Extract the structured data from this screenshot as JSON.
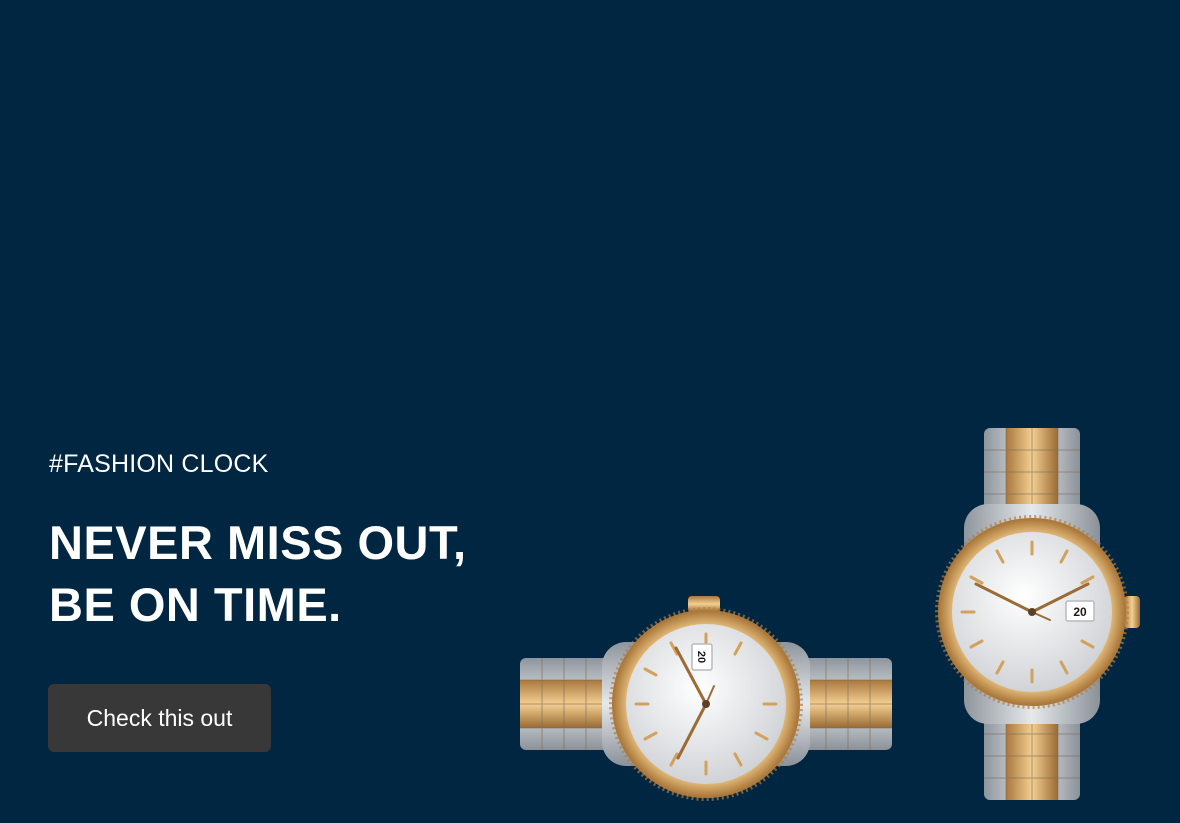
{
  "hero": {
    "tagline": "#FASHION CLOCK",
    "headline_line1": "NEVER MISS OUT,",
    "headline_line2": "BE ON TIME.",
    "cta_label": "Check this out"
  },
  "products": {
    "watch_left": {
      "date": "20",
      "icon": "wristwatch-image"
    },
    "watch_right": {
      "date": "20",
      "icon": "wristwatch-image"
    }
  },
  "colors": {
    "background": "#002642",
    "button": "#383838",
    "gold": "#d9a75f",
    "steel": "#b9bec4"
  }
}
